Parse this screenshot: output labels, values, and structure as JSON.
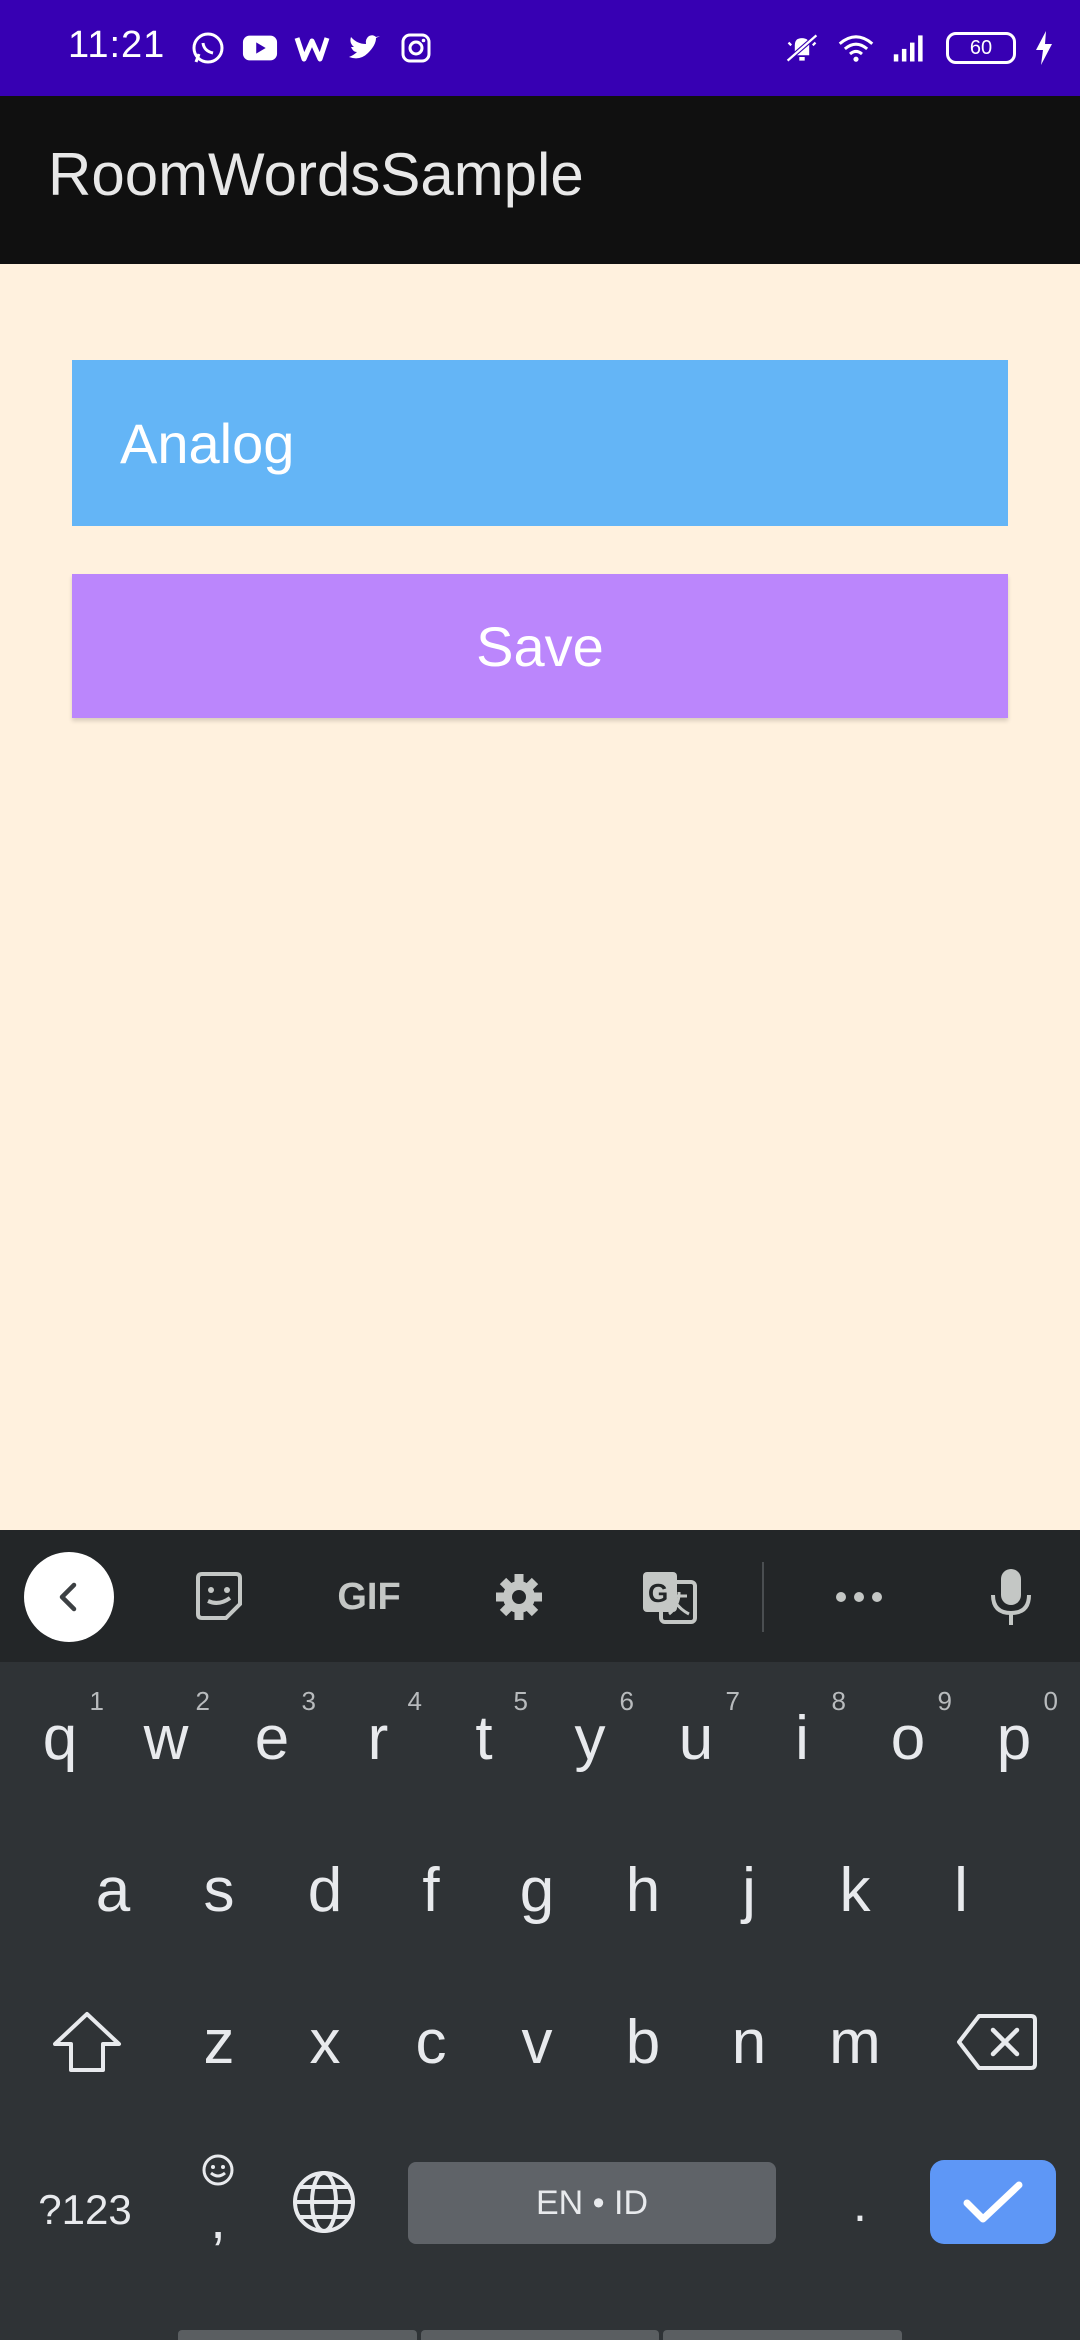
{
  "status_bar": {
    "time": "11:21",
    "battery_level": "60",
    "background_color": "#3700b3",
    "left_icons": [
      "whatsapp-icon",
      "youtube-icon",
      "w-app-icon",
      "twitter-icon",
      "instagram-icon"
    ],
    "right_icons": [
      "mute-icon",
      "wifi-icon",
      "signal-icon",
      "battery-icon",
      "charging-icon"
    ]
  },
  "app_bar": {
    "title": "RoomWordsSample",
    "background_color": "#101010"
  },
  "form": {
    "word_value": "Analog",
    "word_field_color": "#64b5f6",
    "save_label": "Save",
    "save_button_color": "#bb86fc"
  },
  "keyboard": {
    "toolbar_icons": [
      "back-chevron-icon",
      "sticker-icon",
      "gif-icon",
      "settings-icon",
      "translate-icon",
      "more-icon",
      "microphone-icon"
    ],
    "gif_label": "GIF",
    "row1": [
      {
        "k": "q",
        "h": "1"
      },
      {
        "k": "w",
        "h": "2"
      },
      {
        "k": "e",
        "h": "3"
      },
      {
        "k": "r",
        "h": "4"
      },
      {
        "k": "t",
        "h": "5"
      },
      {
        "k": "y",
        "h": "6"
      },
      {
        "k": "u",
        "h": "7"
      },
      {
        "k": "i",
        "h": "8"
      },
      {
        "k": "o",
        "h": "9"
      },
      {
        "k": "p",
        "h": "0"
      }
    ],
    "row2": [
      "a",
      "s",
      "d",
      "f",
      "g",
      "h",
      "j",
      "k",
      "l"
    ],
    "row3": [
      "z",
      "x",
      "c",
      "v",
      "b",
      "n",
      "m"
    ],
    "symbols_label": "?123",
    "comma_label": ",",
    "space_label": "EN • ID",
    "period_label": ".",
    "enter_color": "#5e97f6"
  }
}
